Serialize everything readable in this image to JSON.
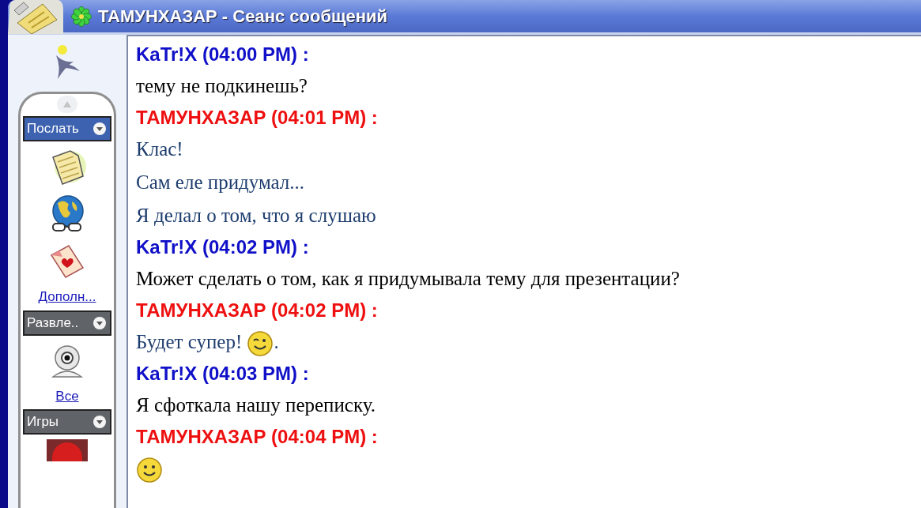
{
  "window": {
    "title": "ТАМУНХАЗАР - Сеанс сообщений"
  },
  "sidebar": {
    "sections": [
      {
        "label": "Послать",
        "selected": true,
        "items": [
          {
            "kind": "note"
          },
          {
            "kind": "globe"
          },
          {
            "kind": "card"
          }
        ],
        "link": "Дополн..."
      },
      {
        "label": "Развле..",
        "selected": false,
        "items": [
          {
            "kind": "webcam"
          }
        ],
        "link": "Все"
      },
      {
        "label": "Игры",
        "selected": false,
        "items": [
          {
            "kind": "game"
          }
        ]
      }
    ]
  },
  "messages": [
    {
      "header": "KaTr!X (04:00 PM) :",
      "outgoing": false,
      "lines": [
        {
          "text": "тему не подкинешь?"
        }
      ]
    },
    {
      "header": "ТАМУНХАЗАР (04:01 PM) :",
      "outgoing": true,
      "lines": [
        {
          "text": "Клас!"
        },
        {
          "text": "Сам еле придумал..."
        },
        {
          "text": "Я делал о том, что я слушаю"
        }
      ]
    },
    {
      "header": "KaTr!X (04:02 PM) :",
      "outgoing": false,
      "lines": [
        {
          "text": "Может сделать о том, как я придумывала тему для презентации?"
        }
      ]
    },
    {
      "header": "ТАМУНХАЗАР (04:02 PM) :",
      "outgoing": true,
      "lines": [
        {
          "text": "Будет супер!",
          "kind": "wink",
          "after": "."
        }
      ]
    },
    {
      "header": "KaTr!X (04:03 PM) :",
      "outgoing": false,
      "lines": [
        {
          "text": "Я сфоткала нашу переписку."
        }
      ]
    },
    {
      "header": "ТАМУНХАЗАР (04:04 PM) :",
      "outgoing": true,
      "lines": [
        {
          "kind": "smile"
        }
      ]
    }
  ]
}
